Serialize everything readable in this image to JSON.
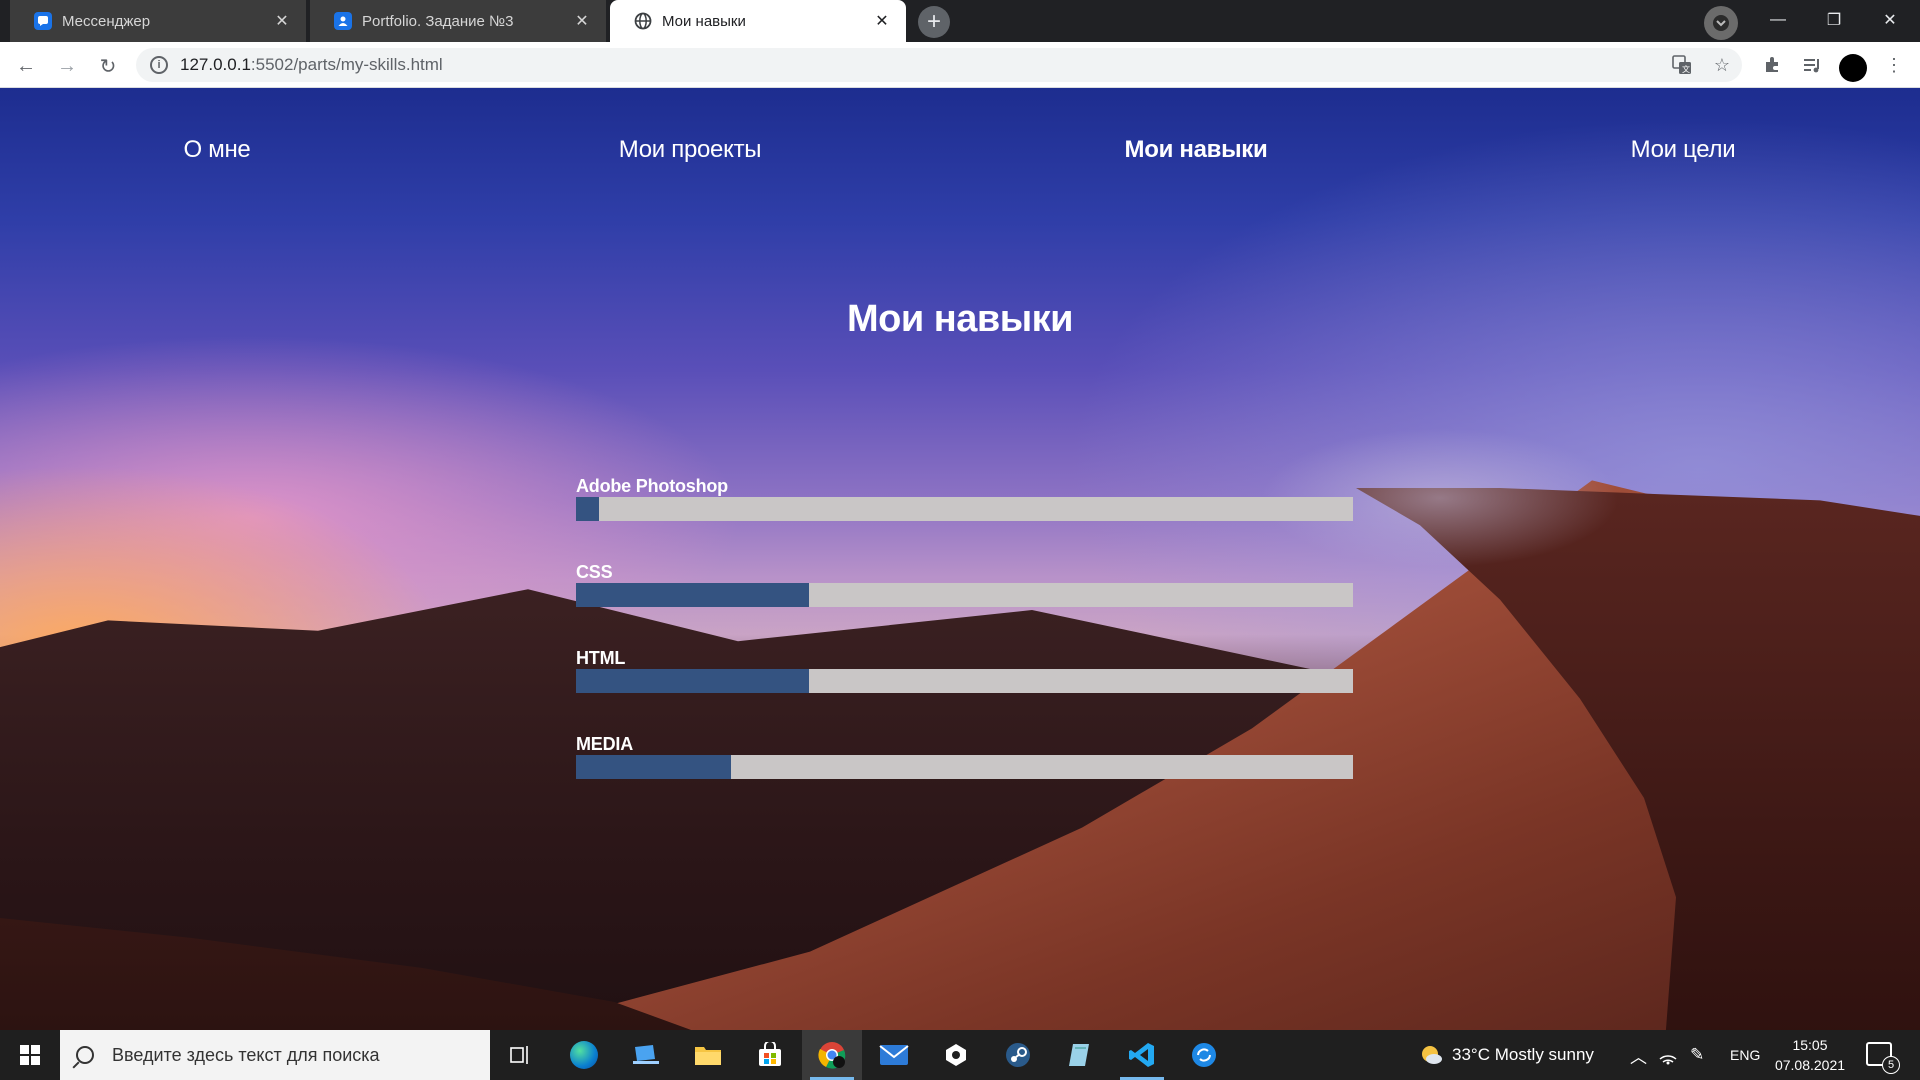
{
  "browser": {
    "tabs": [
      {
        "title": "Мессенджер",
        "icon": "messenger-icon",
        "active": false
      },
      {
        "title": "Portfolio. Задание №3",
        "icon": "contact-icon",
        "active": false
      },
      {
        "title": "Мои навыки",
        "icon": "globe-icon",
        "active": true
      }
    ],
    "new_tab": "+",
    "address": {
      "host": "127.0.0.1",
      "rest": ":5502/parts/my-skills.html"
    }
  },
  "site": {
    "nav": [
      {
        "label": "О мне",
        "current": false
      },
      {
        "label": "Мои проекты",
        "current": false
      },
      {
        "label": "Мои навыки",
        "current": true
      },
      {
        "label": "Мои цели",
        "current": false
      }
    ],
    "title": "Мои навыки",
    "skills": [
      {
        "name": "Adobe Photoshop",
        "level_percent": 3
      },
      {
        "name": "CSS",
        "level_percent": 30
      },
      {
        "name": "HTML",
        "level_percent": 30
      },
      {
        "name": "MEDIA",
        "level_percent": 20
      }
    ],
    "colors": {
      "bar_fill": "#345381",
      "bar_track": "#c9c6c6"
    }
  },
  "taskbar": {
    "search_placeholder": "Введите здесь текст для поиска",
    "apps": [
      "task-view-icon",
      "edge-icon",
      "device-icon",
      "file-explorer-icon",
      "store-icon",
      "chrome-icon",
      "mail-icon",
      "unity-icon",
      "steam-icon",
      "notes-icon",
      "vscode-icon",
      "sync-icon"
    ],
    "weather": "33°C  Mostly sunny",
    "language": "ENG",
    "time": "15:05",
    "date": "07.08.2021",
    "notification_count": "5"
  }
}
